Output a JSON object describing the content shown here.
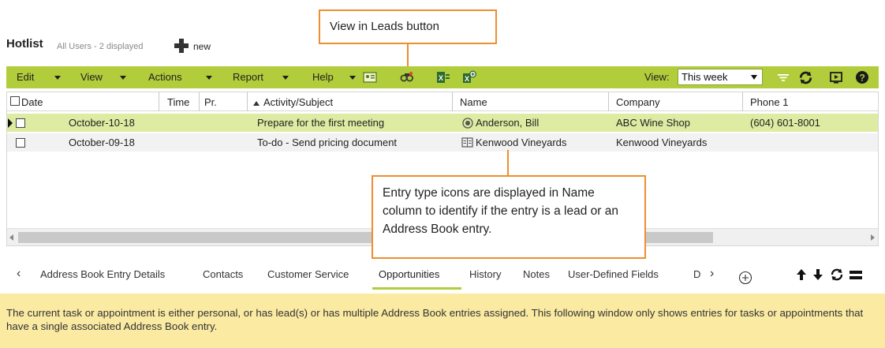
{
  "header": {
    "title": "Hotlist",
    "subtitle": "All Users - 2 displayed",
    "new_label": "new"
  },
  "callouts": {
    "top": "View in Leads button",
    "bottom": "Entry type icons are displayed in Name column to identify if the entry is a lead or an Address Book entry."
  },
  "toolbar": {
    "menus": [
      "Edit",
      "View",
      "Actions",
      "Report",
      "Help"
    ],
    "view_label": "View:",
    "view_value": "This week",
    "icons": [
      "address-card-icon",
      "view-in-leads-icon",
      "excel-export-icon",
      "excel-import-icon",
      "filter-icon",
      "refresh-icon",
      "play-icon",
      "help-icon"
    ],
    "accent_color": "#b1cd3b"
  },
  "grid": {
    "columns": [
      "Date",
      "Time",
      "Pr.",
      "Activity/Subject",
      "Name",
      "Company",
      "Phone 1"
    ],
    "rows": [
      {
        "date": "October-10-18",
        "time": "",
        "pr": "",
        "subject": "Prepare for the first meeting",
        "name": "Anderson, Bill",
        "name_icon": "lead-icon",
        "company": "ABC Wine Shop",
        "phone": "(604) 601-8001"
      },
      {
        "date": "October-09-18",
        "time": "",
        "pr": "",
        "subject": "To-do - Send pricing document",
        "name": "Kenwood Vineyards",
        "name_icon": "address-book-icon",
        "company": "Kenwood Vineyards",
        "phone": ""
      }
    ],
    "selected_color": "#ddeba3"
  },
  "tabs": {
    "items": [
      "Address Book Entry Details",
      "Contacts",
      "Customer Service",
      "Opportunities",
      "History",
      "Notes",
      "User-Defined Fields",
      "D"
    ],
    "active": "Opportunities"
  },
  "info": {
    "message": "The current task or appointment is either personal, or has lead(s) or has multiple Address Book entries assigned. This following window only shows entries for tasks or appointments that have a single associated Address Book entry."
  }
}
